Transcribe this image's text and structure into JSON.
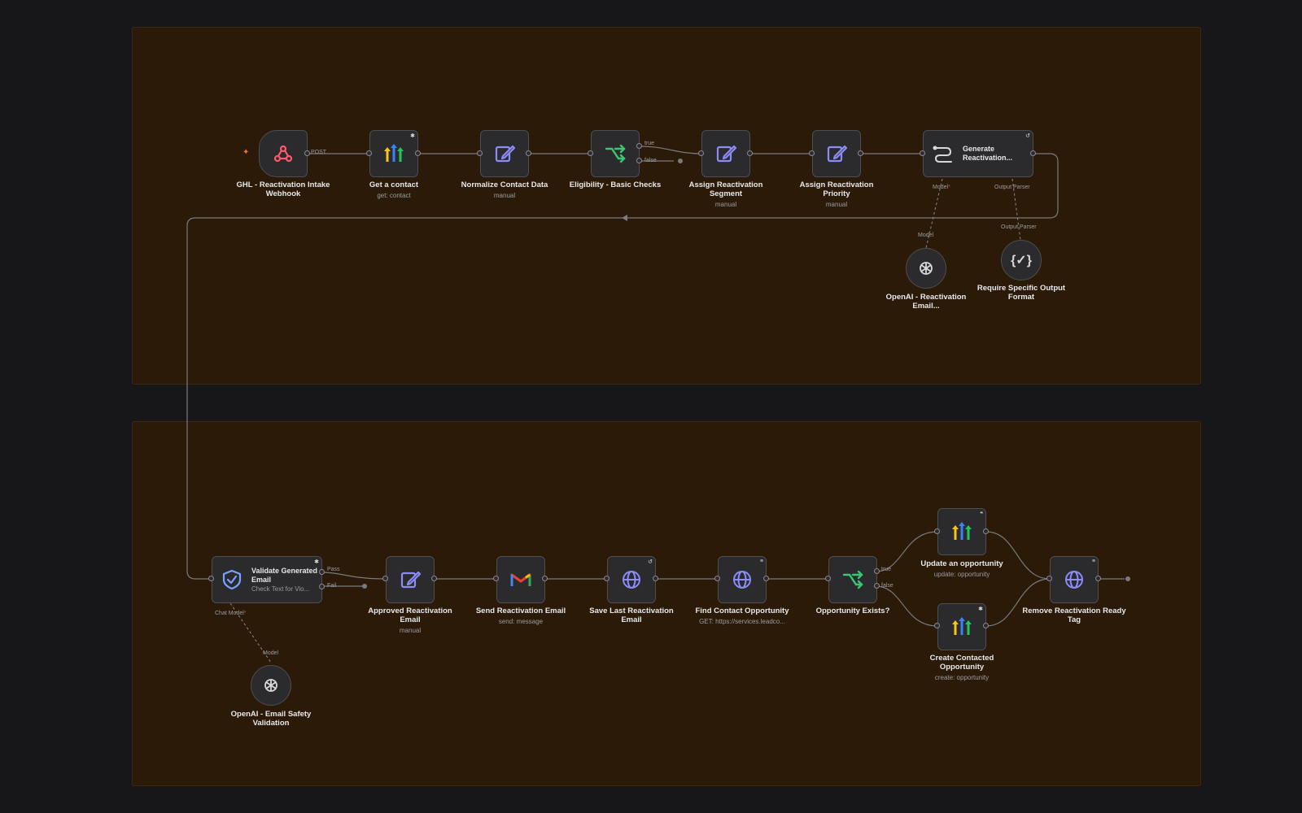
{
  "workflow": {
    "top_row": [
      {
        "id": "webhook",
        "name": "GHL - Reactivation Intake Webhook",
        "sub": "",
        "icon": "webhook-icon"
      },
      {
        "id": "getcontact",
        "name": "Get a contact",
        "sub": "get: contact",
        "icon": "highlevel-icon"
      },
      {
        "id": "normalize",
        "name": "Normalize Contact Data",
        "sub": "manual",
        "icon": "edit-icon"
      },
      {
        "id": "eligibility",
        "name": "Eligibility - Basic Checks",
        "sub": "",
        "icon": "if-icon"
      },
      {
        "id": "segment",
        "name": "Assign Reactivation Segment",
        "sub": "manual",
        "icon": "edit-icon"
      },
      {
        "id": "priority",
        "name": "Assign Reactivation Priority",
        "sub": "manual",
        "icon": "edit-icon"
      }
    ],
    "generate": {
      "title": "Generate Reactivation...",
      "model_port": "Model",
      "parser_port": "Output Parser"
    },
    "webhook_method": "POST",
    "eligibility_true": "true",
    "eligibility_false": "false",
    "openai_top": {
      "name": "OpenAI - Reactivation Email...",
      "port": "Model"
    },
    "parser_node": {
      "name": "Require Specific Output Format",
      "port": "Output Parser"
    },
    "validate": {
      "title": "Validate Generated Email",
      "sub": "Check Text for Vio...",
      "pass": "Pass",
      "fail": "Fail",
      "model_port": "Chat Model"
    },
    "openai_bottom": {
      "name": "OpenAI - Email Safety Validation",
      "port": "Model"
    },
    "bottom_row": [
      {
        "id": "approved",
        "name": "Approved Reactivation Email",
        "sub": "manual",
        "icon": "edit-icon"
      },
      {
        "id": "send",
        "name": "Send Reactivation Email",
        "sub": "send: message",
        "icon": "gmail-icon"
      },
      {
        "id": "savelast",
        "name": "Save Last Reactivation Email",
        "sub": "",
        "icon": "globe-icon"
      },
      {
        "id": "findopp",
        "name": "Find Contact Opportunity",
        "sub": "GET: https://services.leadco...",
        "icon": "globe-icon"
      },
      {
        "id": "oppexists",
        "name": "Opportunity Exists?",
        "sub": "",
        "icon": "if-icon"
      }
    ],
    "opp_true": "true",
    "opp_false": "false",
    "update_opp": {
      "name": "Update an opportunity",
      "sub": "update: opportunity"
    },
    "create_opp": {
      "name": "Create Contacted Opportunity",
      "sub": "create: opportunity"
    },
    "remove_tag": {
      "name": "Remove Reactivation Ready Tag",
      "sub": ""
    }
  },
  "colors": {
    "canvas": "#17171a",
    "sticky": "#2a1a07",
    "wire": "#7a7a80",
    "webhook": "#ff5a6e",
    "edit": "#8b8cf6",
    "if": "#37c871",
    "globe": "#8b8cf6"
  }
}
